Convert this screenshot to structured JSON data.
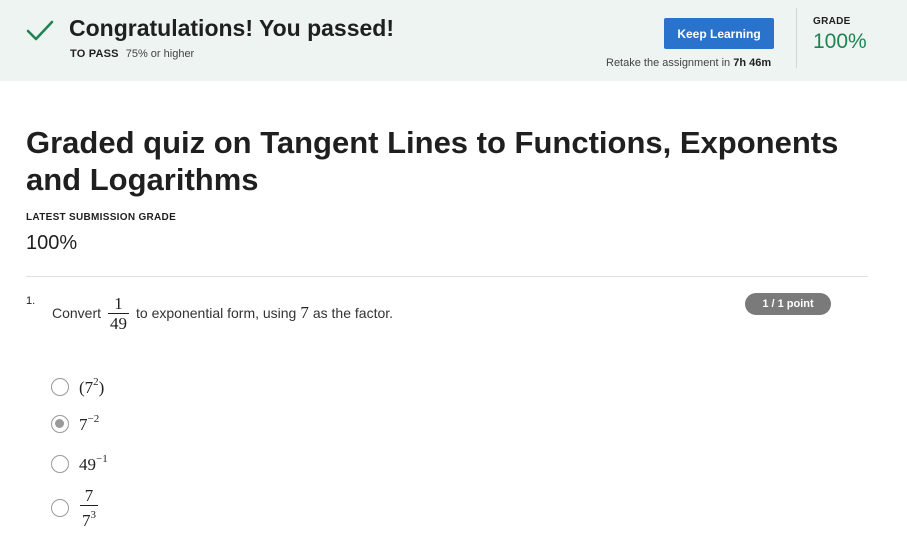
{
  "banner": {
    "title": "Congratulations! You passed!",
    "to_pass_label": "TO PASS",
    "to_pass_value": "75% or higher",
    "keep_learning_label": "Keep Learning",
    "retake_prefix": "Retake the assignment in",
    "retake_time": "7h 46m",
    "grade_label": "GRADE",
    "grade_value": "100%"
  },
  "quiz": {
    "title": "Graded quiz on Tangent Lines to Functions, Exponents and Logarithms",
    "latest_label": "LATEST SUBMISSION GRADE",
    "latest_value": "100%"
  },
  "question": {
    "number": "1.",
    "prefix": "Convert",
    "frac_num": "1",
    "frac_den": "49",
    "middle": "to exponential form, using",
    "factor": "7",
    "suffix": "as the factor.",
    "points": "1 / 1 point",
    "options": [
      {
        "base": "(7",
        "exp": "2",
        "close": ")",
        "selected": false
      },
      {
        "base": "7",
        "exp": "−2",
        "selected": true
      },
      {
        "base": "49",
        "exp": "−1",
        "selected": false
      },
      {
        "num": "7",
        "den_base": "7",
        "den_exp": "3",
        "selected": false
      }
    ]
  },
  "colors": {
    "accent": "#2a73cc",
    "success": "#1f8354",
    "banner_bg": "#eef4f1",
    "badge": "#7a7a7a"
  }
}
